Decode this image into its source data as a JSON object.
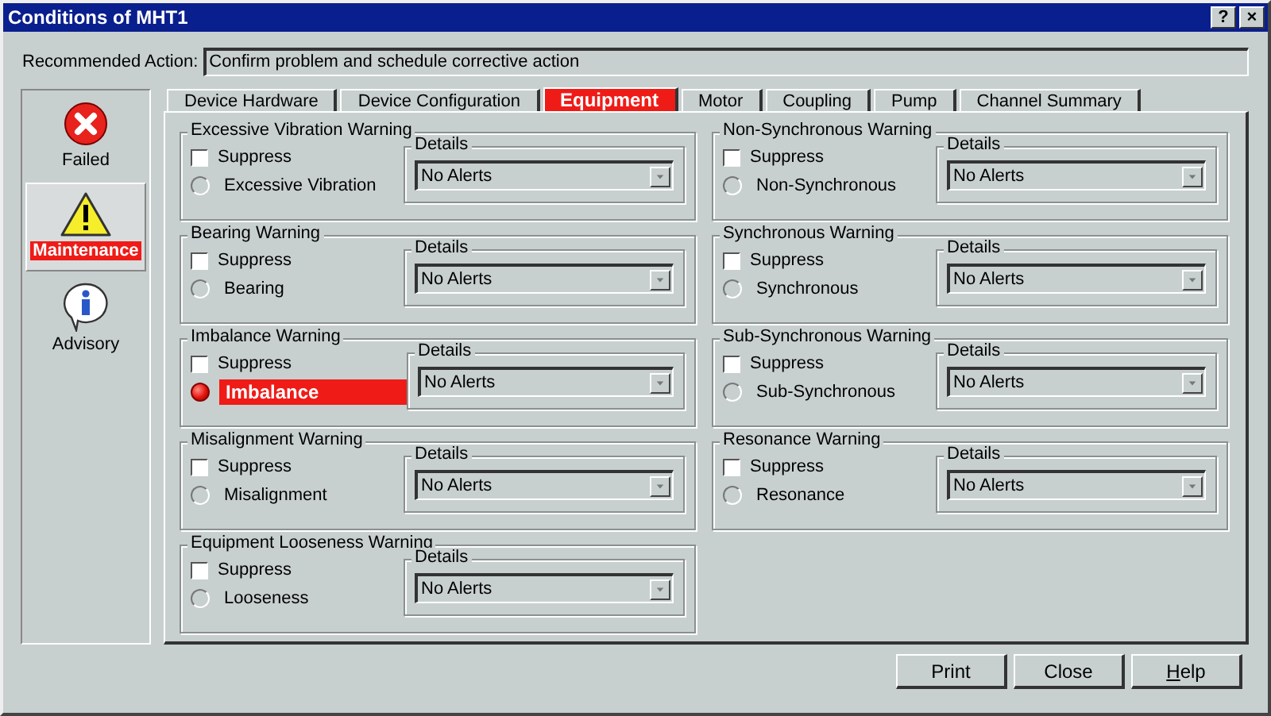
{
  "window": {
    "title": "Conditions of MHT1",
    "title_buttons": [
      "?",
      "×"
    ]
  },
  "recommended_action": {
    "label": "Recommended Action:",
    "value": "Confirm problem and schedule corrective action"
  },
  "sidebar": {
    "items": [
      {
        "kind": "failed",
        "label": "Failed",
        "selected": false
      },
      {
        "kind": "warning",
        "label": "Maintenance",
        "selected": true
      },
      {
        "kind": "info",
        "label": "Advisory",
        "selected": false
      }
    ]
  },
  "tabs": [
    {
      "label": "Device Hardware",
      "selected": false
    },
    {
      "label": "Device Configuration",
      "selected": false
    },
    {
      "label": "Equipment",
      "selected": true
    },
    {
      "label": "Motor",
      "selected": false
    },
    {
      "label": "Coupling",
      "selected": false
    },
    {
      "label": "Pump",
      "selected": false
    },
    {
      "label": "Channel Summary",
      "selected": false
    }
  ],
  "columns": [
    {
      "groups": [
        {
          "title": "Excessive Vibration Warning",
          "suppress": "Suppress",
          "checked": false,
          "condition": "Excessive Vibration",
          "active": false,
          "details": "Details",
          "value": "No Alerts"
        },
        {
          "title": "Bearing Warning",
          "suppress": "Suppress",
          "checked": false,
          "condition": "Bearing",
          "active": false,
          "details": "Details",
          "value": "No Alerts"
        },
        {
          "title": "Imbalance Warning",
          "suppress": "Suppress",
          "checked": false,
          "condition": "Imbalance",
          "active": true,
          "details": "Details",
          "value": "No Alerts"
        },
        {
          "title": "Misalignment Warning",
          "suppress": "Suppress",
          "checked": false,
          "condition": "Misalignment",
          "active": false,
          "details": "Details",
          "value": "No Alerts"
        },
        {
          "title": "Equipment Looseness Warning",
          "suppress": "Suppress",
          "checked": false,
          "condition": "Looseness",
          "active": false,
          "details": "Details",
          "value": "No Alerts"
        }
      ]
    },
    {
      "groups": [
        {
          "title": "Non-Synchronous Warning",
          "suppress": "Suppress",
          "checked": false,
          "condition": "Non-Synchronous",
          "active": false,
          "details": "Details",
          "value": "No Alerts"
        },
        {
          "title": "Synchronous Warning",
          "suppress": "Suppress",
          "checked": false,
          "condition": "Synchronous",
          "active": false,
          "details": "Details",
          "value": "No Alerts"
        },
        {
          "title": "Sub-Synchronous Warning",
          "suppress": "Suppress",
          "checked": false,
          "condition": "Sub-Synchronous",
          "active": false,
          "details": "Details",
          "value": "No Alerts"
        },
        {
          "title": "Resonance Warning",
          "suppress": "Suppress",
          "checked": false,
          "condition": "Resonance",
          "active": false,
          "details": "Details",
          "value": "No Alerts"
        }
      ]
    }
  ],
  "buttons": [
    {
      "label": "Print",
      "underlined_first": false
    },
    {
      "label": "Close",
      "underlined_first": false
    },
    {
      "label": "Help",
      "underlined_first": true
    }
  ]
}
